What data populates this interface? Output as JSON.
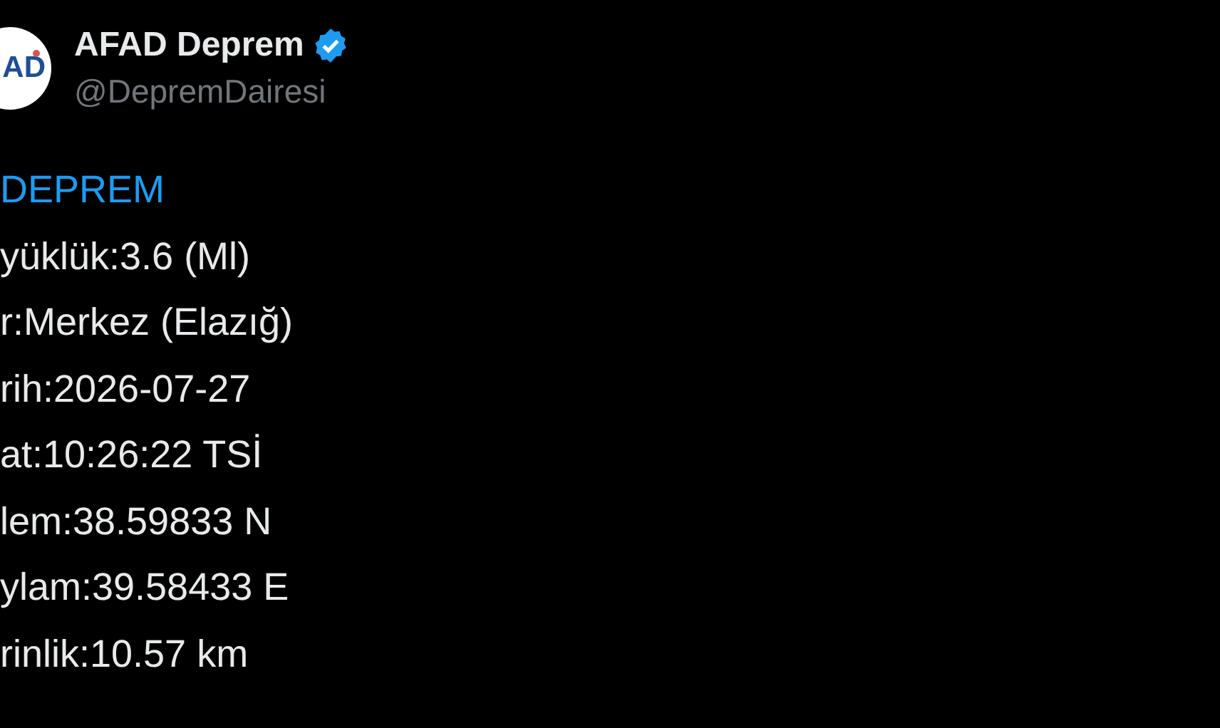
{
  "post": {
    "avatar_text": "AD",
    "author": "AFAD Deprem",
    "verified": true,
    "handle": "@DepremDairesi",
    "hashtag": "DEPREM",
    "lines": [
      "yüklük:3.6 (Ml)",
      "r:Merkez (Elazığ)",
      "rih:2026-07-27",
      "at:10:26:22 TSİ",
      "lem:38.59833 N",
      "ylam:39.58433 E",
      "rinlik:10.57 km"
    ]
  }
}
